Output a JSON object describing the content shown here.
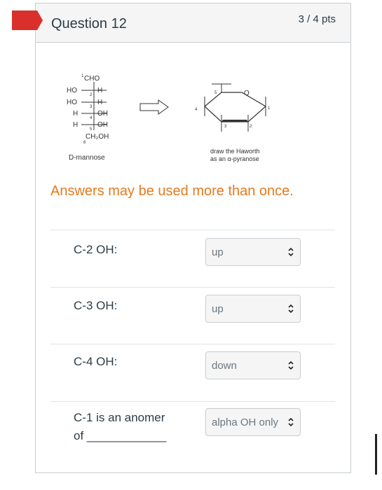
{
  "question": {
    "title": "Question 12",
    "points": "3 / 4 pts"
  },
  "diagram": {
    "fischer": {
      "top": "CHO",
      "rows": [
        {
          "left": "HO",
          "right": "H",
          "num": "2"
        },
        {
          "left": "HO",
          "right": "H",
          "num": "3"
        },
        {
          "left": "H",
          "right": "OH",
          "num": "4"
        },
        {
          "left": "H",
          "right": "OH",
          "num": "5"
        }
      ],
      "bottom": "CH₂OH",
      "top_num": "1",
      "bottom_num": "6",
      "caption": "D-mannose"
    },
    "haworth": {
      "ring_o": "O",
      "nums": [
        "5",
        "4",
        "3",
        "2",
        "1"
      ],
      "caption_line1": "draw the Haworth",
      "caption_line2": "as an α-pyranose"
    }
  },
  "note": "Answers may be used more than once.",
  "rows": [
    {
      "label_line1": "C-2 OH:",
      "label_line2": "",
      "selected": "up"
    },
    {
      "label_line1": "C-3 OH:",
      "label_line2": "",
      "selected": "up"
    },
    {
      "label_line1": "C-4 OH:",
      "label_line2": "",
      "selected": "down"
    },
    {
      "label_line1": "C-1 is an anomer",
      "label_line2": "of ____________",
      "selected": "alpha OH only"
    }
  ],
  "colors": {
    "flag": "#d9302c",
    "note": "#e8791b",
    "text": "#2d3b45"
  }
}
